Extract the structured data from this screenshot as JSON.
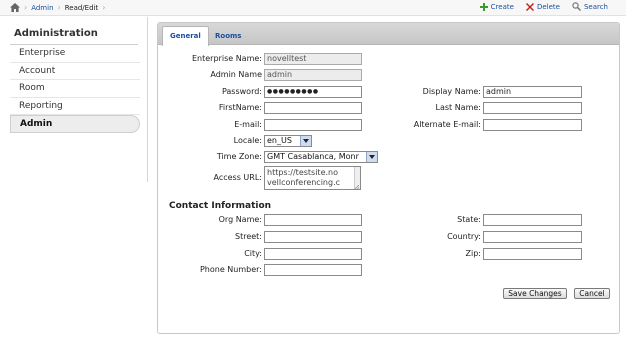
{
  "breadcrumb": {
    "items": [
      "Admin",
      "Read/Edit"
    ]
  },
  "toolbar": {
    "create_label": "Create",
    "delete_label": "Delete",
    "search_label": "Search"
  },
  "sidebar": {
    "title": "Administration",
    "items": [
      {
        "label": "Enterprise"
      },
      {
        "label": "Account"
      },
      {
        "label": "Room"
      },
      {
        "label": "Reporting"
      },
      {
        "label": "Admin",
        "active": true
      }
    ]
  },
  "tabs": [
    {
      "label": "General",
      "active": true
    },
    {
      "label": "Rooms"
    }
  ],
  "form": {
    "enterprise_name": {
      "label": "Enterprise Name:",
      "value": "novelltest"
    },
    "admin_name": {
      "label": "Admin Name",
      "value": "admin"
    },
    "password": {
      "label": "Password:",
      "value": "●●●●●●●●●"
    },
    "first_name": {
      "label": "FirstName:",
      "value": ""
    },
    "email": {
      "label": "E-mail:",
      "value": ""
    },
    "locale": {
      "label": "Locale:",
      "value": "en_US"
    },
    "time_zone": {
      "label": "Time Zone:",
      "value": "GMT Casablanca, Monr"
    },
    "access_url": {
      "label": "Access URL:",
      "value": "https://testsite.no vellconferencing.c"
    },
    "display_name": {
      "label": "Display Name:",
      "value": "admin"
    },
    "last_name": {
      "label": "Last Name:",
      "value": ""
    },
    "alternate_email": {
      "label": "Alternate E-mail:",
      "value": ""
    }
  },
  "contact": {
    "title": "Contact Information",
    "org_name": {
      "label": "Org Name:",
      "value": ""
    },
    "street": {
      "label": "Street:",
      "value": ""
    },
    "city": {
      "label": "City:",
      "value": ""
    },
    "phone": {
      "label": "Phone Number:",
      "value": ""
    },
    "state": {
      "label": "State:",
      "value": ""
    },
    "country": {
      "label": "Country:",
      "value": ""
    },
    "zip": {
      "label": "Zip:",
      "value": ""
    }
  },
  "buttons": {
    "save_label": "Save Changes",
    "cancel_label": "Cancel"
  },
  "colors": {
    "link": "#1b4f9c",
    "create_icon": "#3a9a2a",
    "delete_icon": "#c0201a"
  },
  "icons": [
    "home-icon",
    "plus-icon",
    "x-icon",
    "magnifier-icon",
    "chevron-down-icon"
  ]
}
